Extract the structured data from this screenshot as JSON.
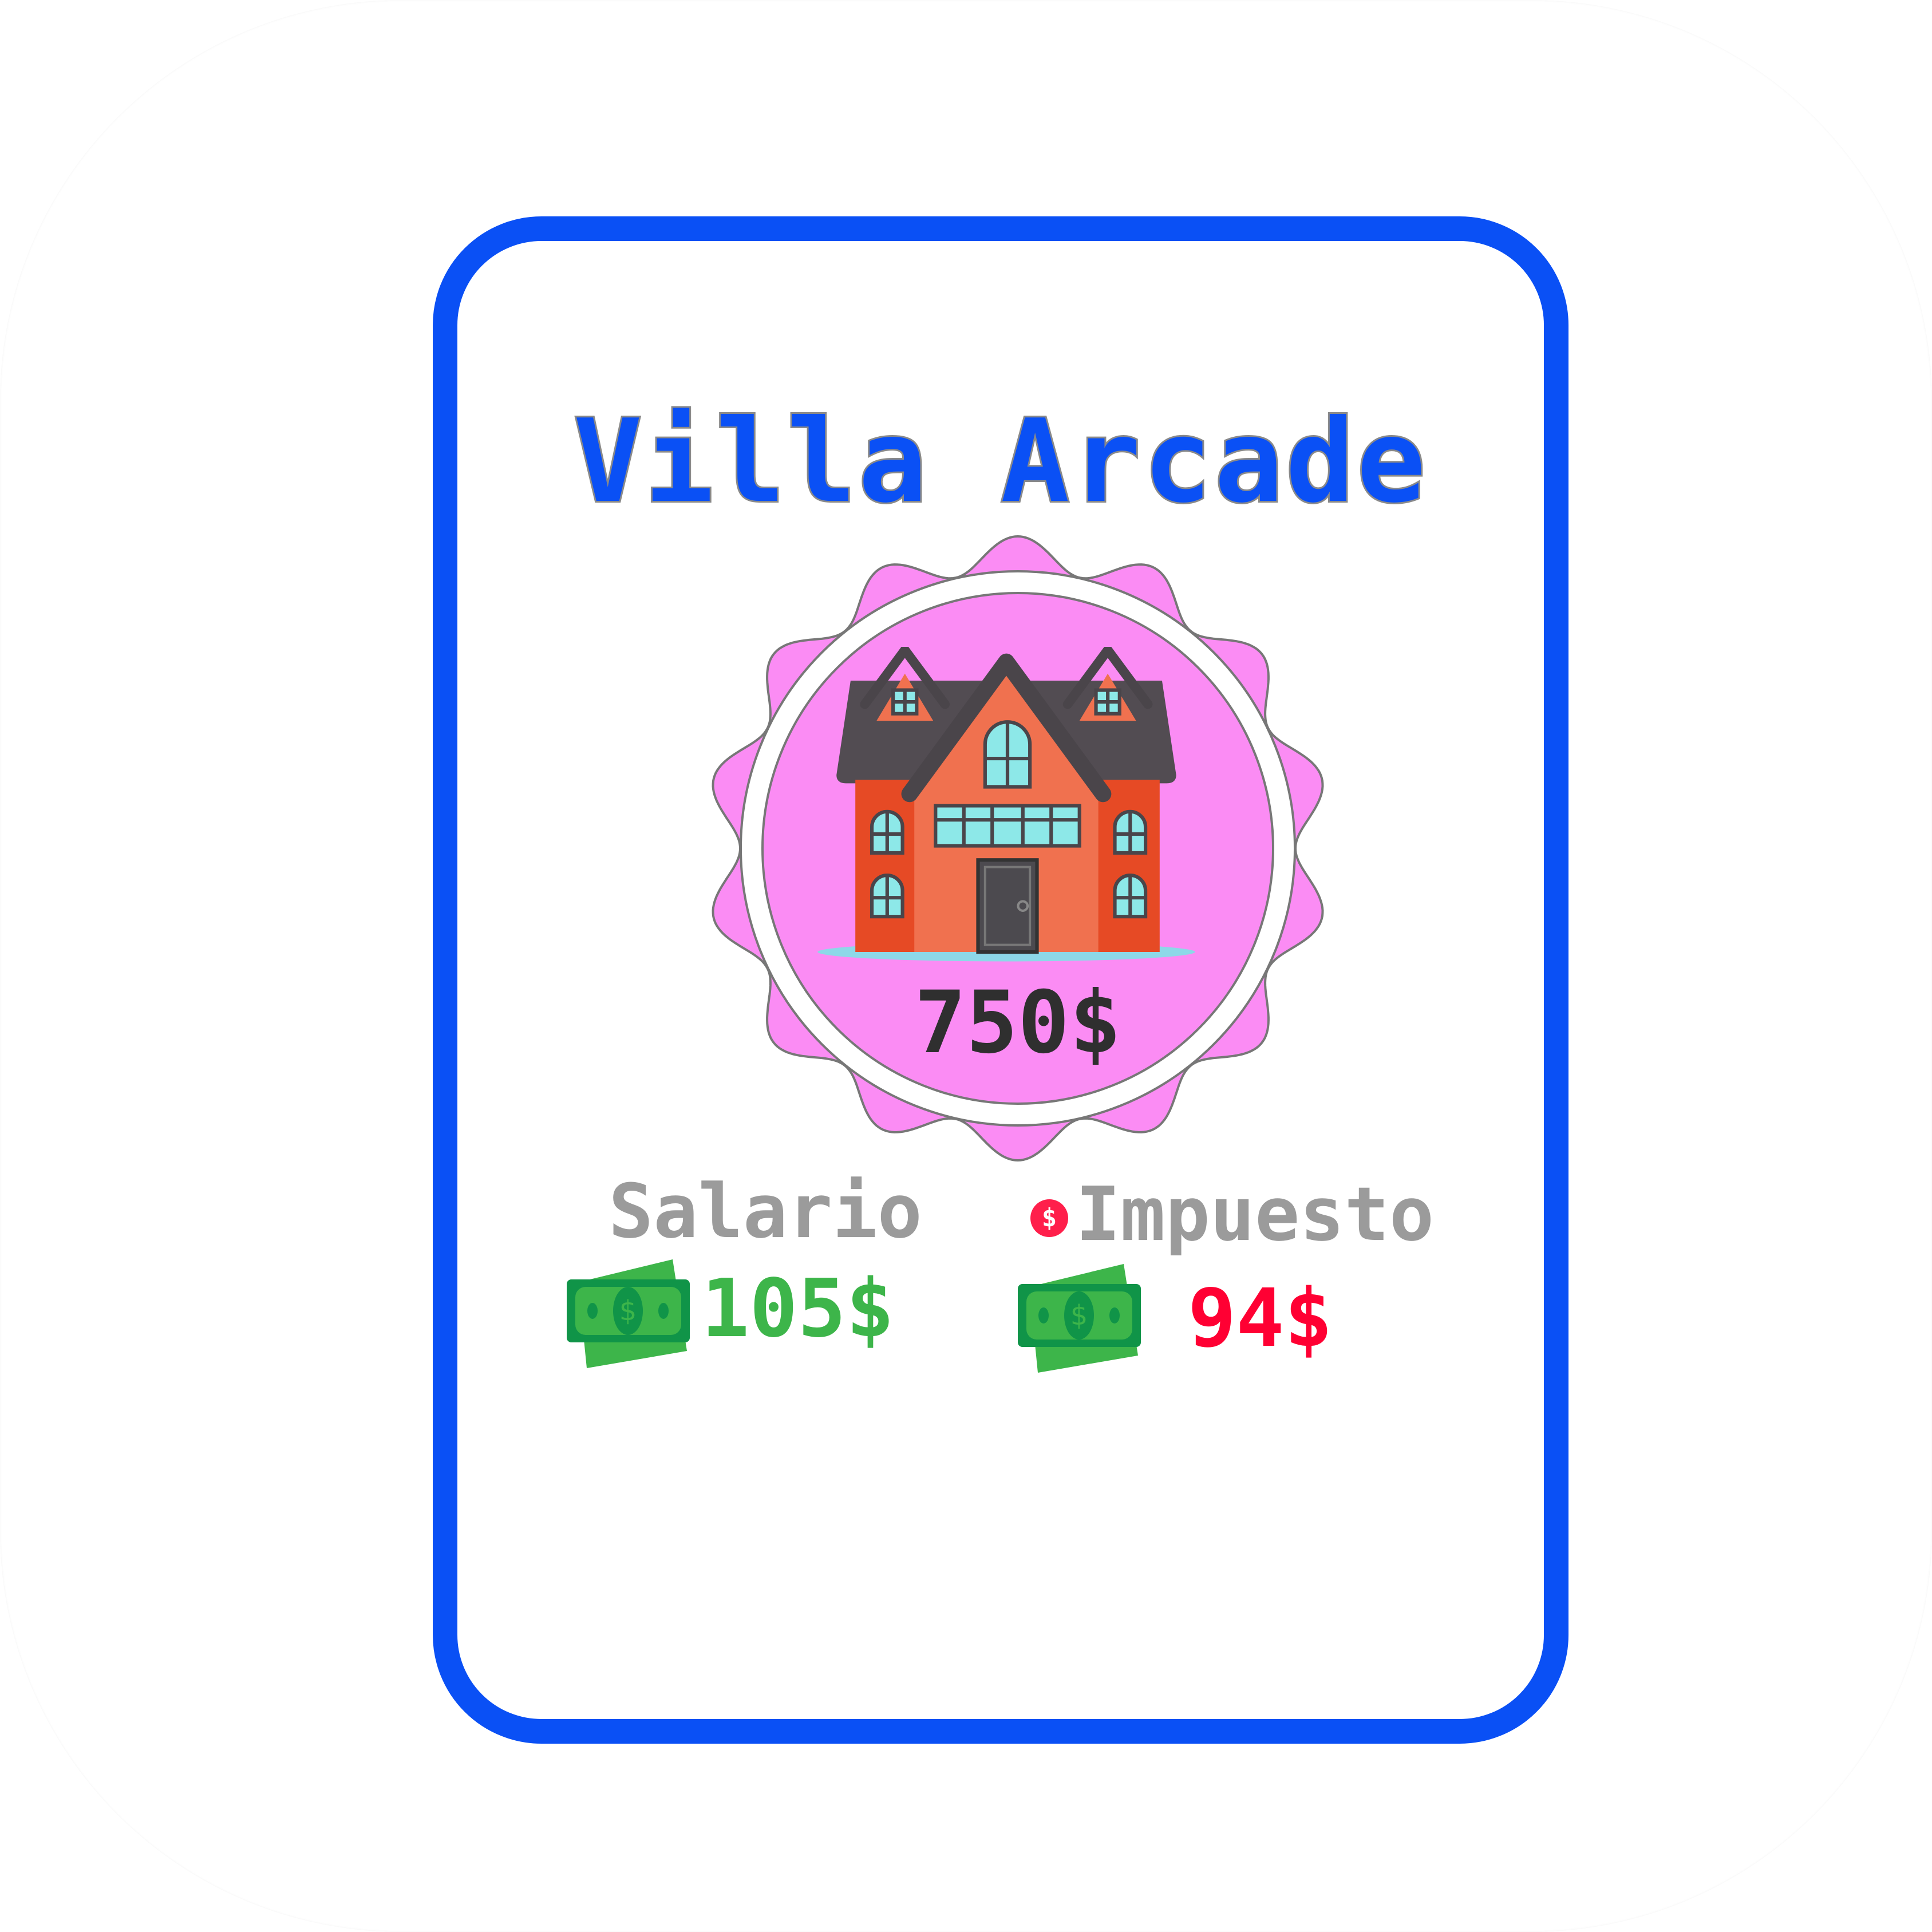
{
  "card": {
    "title": "Villa Arcade",
    "price": "750$",
    "salary": {
      "label": "Salario",
      "amount": "105$",
      "icon": "money-bill-icon"
    },
    "tax": {
      "label": "Impuesto",
      "amount": "94$",
      "icon": "money-bill-icon",
      "badge_icon": "dollar-coin-icon",
      "coin_symbol": "$"
    }
  },
  "colors": {
    "border": "#0a50f5",
    "badge": "#fb8cf4",
    "salary": "#3db54a",
    "tax": "#ff0033",
    "label": "#9b9b9b"
  }
}
